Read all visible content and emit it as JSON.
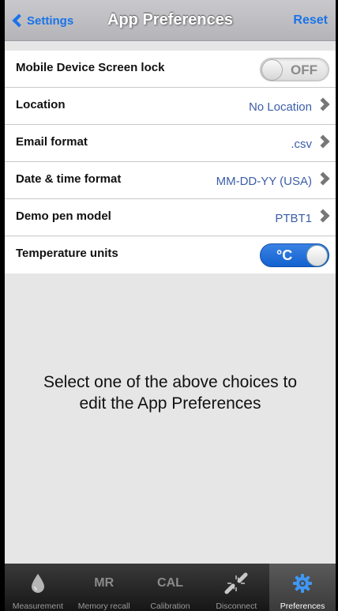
{
  "nav": {
    "back_label": "Settings",
    "title": "App Preferences",
    "reset_label": "Reset"
  },
  "settings": [
    {
      "label": "Mobile Device Screen lock",
      "type": "toggle",
      "toggle_text": "OFF",
      "on": false
    },
    {
      "label": "Location",
      "type": "link",
      "value": "No Location"
    },
    {
      "label": "Email format",
      "type": "link",
      "value": ".csv"
    },
    {
      "label": "Date & time format",
      "type": "link",
      "value": "MM-DD-YY (USA)"
    },
    {
      "label": "Demo pen model",
      "type": "link",
      "value": "PTBT1"
    },
    {
      "label": "Temperature units",
      "type": "toggle",
      "toggle_text": "°C",
      "on": true
    }
  ],
  "helper_text": "Select one of the above choices to edit the App Preferences",
  "tabs": [
    {
      "label": "Measurement",
      "icon": "drop-icon",
      "icon_text": ""
    },
    {
      "label": "Memory recall",
      "icon": "mr-icon",
      "icon_text": "MR"
    },
    {
      "label": "Calibration",
      "icon": "cal-icon",
      "icon_text": "CAL"
    },
    {
      "label": "Disconnect",
      "icon": "disconnect-icon",
      "icon_text": ""
    },
    {
      "label": "Preferences",
      "icon": "gear-icon",
      "icon_text": "",
      "active": true
    }
  ],
  "colors": {
    "accent": "#1a73e8",
    "value_text": "#3b5ea8",
    "toggle_on": "#1a6fdc",
    "background": "#e6e6e6"
  }
}
